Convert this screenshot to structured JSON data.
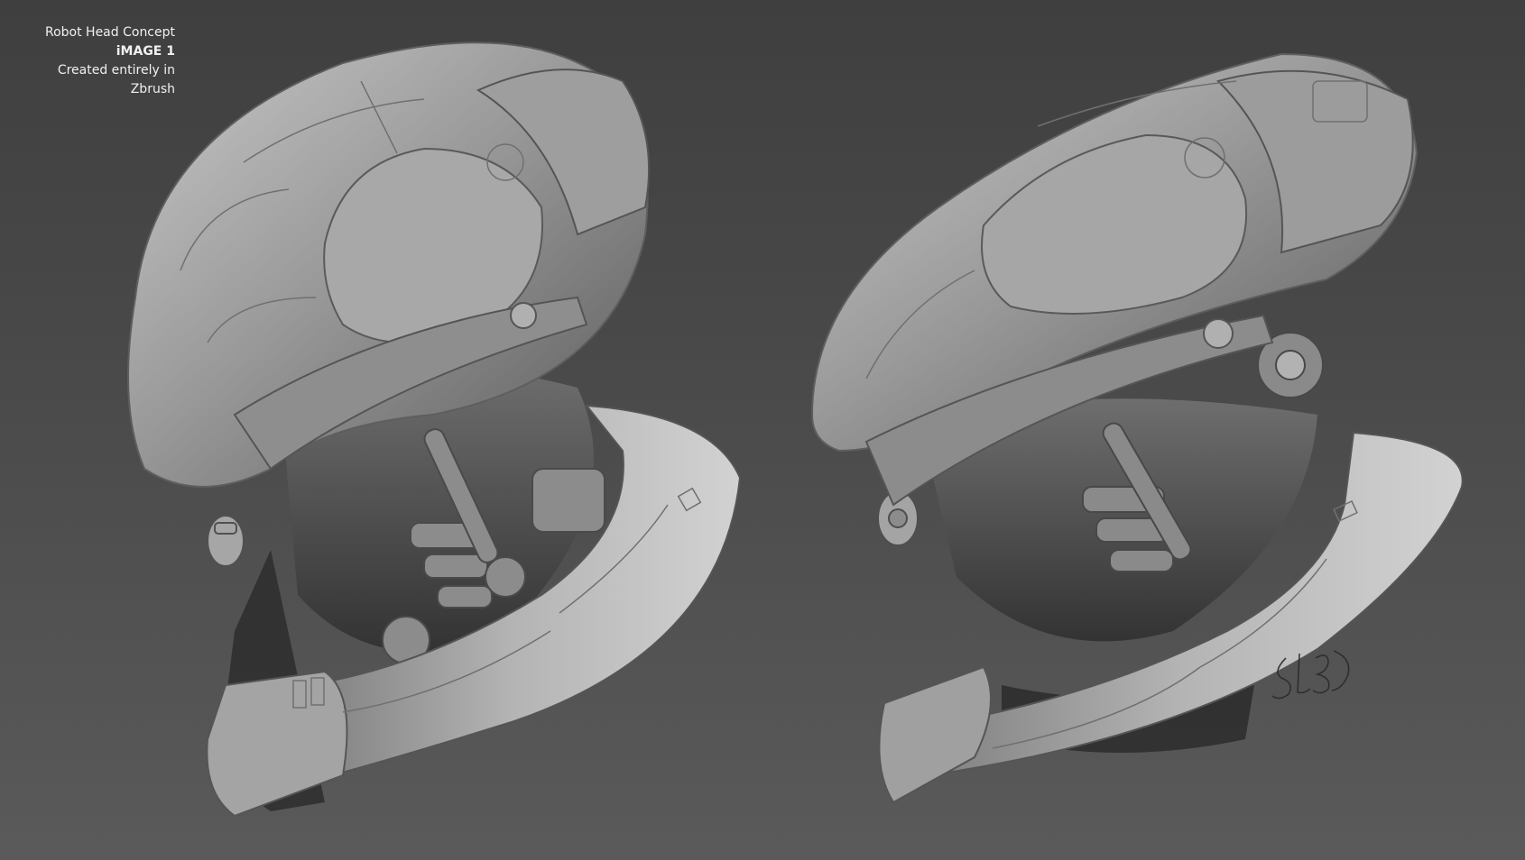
{
  "caption": {
    "title": "Robot Head Concept",
    "image_label": "iMAGE 1",
    "subtitle": "Created entirely in Zbrush"
  },
  "signature": "SL3D",
  "colors": {
    "background_top": "#3f3f3f",
    "background_bottom": "#5a5a5a",
    "clay_light": "#b9b9b9",
    "clay_mid": "#8a8a8a",
    "clay_dark": "#4a4a4a",
    "caption_text": "#f0f0f0"
  }
}
